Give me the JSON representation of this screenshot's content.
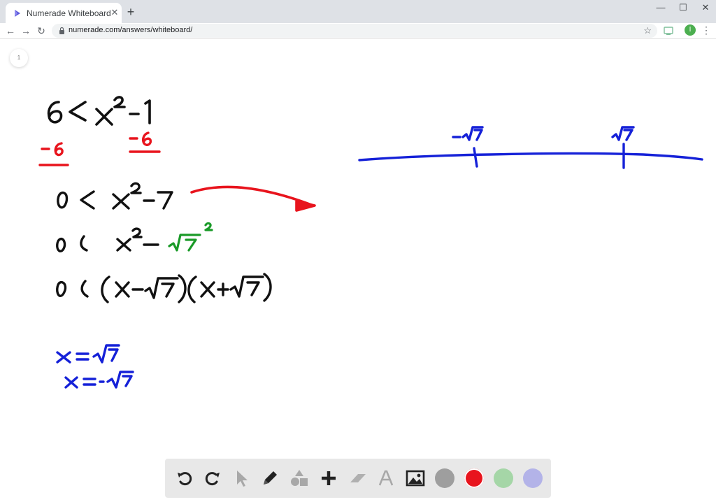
{
  "browser": {
    "tab_title": "Numerade Whiteboard",
    "tab_close": "✕",
    "new_tab": "+",
    "url": "numerade.com/answers/whiteboard/",
    "profile_initial": "I",
    "window_controls": {
      "minimize": "—",
      "maximize": "☐",
      "close": "✕"
    }
  },
  "whiteboard": {
    "page_number": "1",
    "toolbar": {
      "tools": [
        "undo-icon",
        "redo-icon",
        "pointer-icon",
        "pencil-icon",
        "shapes-icon",
        "plus-icon",
        "eraser-icon",
        "text-icon",
        "image-icon"
      ],
      "colors": [
        "#9e9e9e",
        "#e8141d",
        "#a5d6a7",
        "#b3b3e8"
      ],
      "selected_color": "#e8141d"
    }
  }
}
